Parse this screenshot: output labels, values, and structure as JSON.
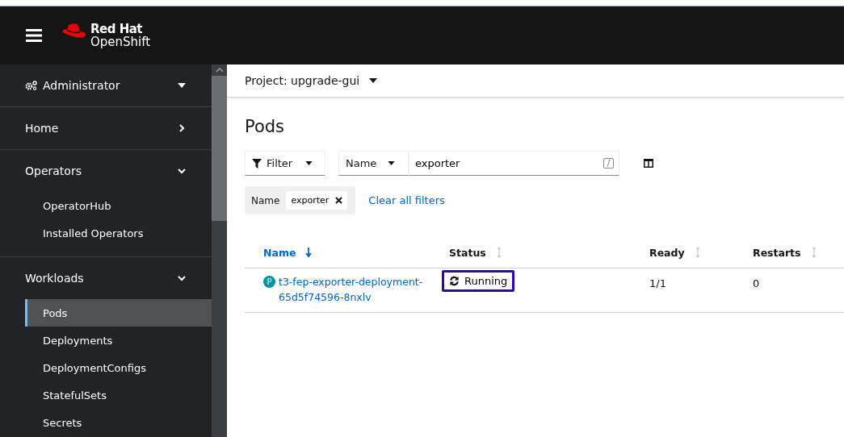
{
  "header": {
    "brand_line_1": "Red Hat",
    "brand_line_2": "OpenShift"
  },
  "sidebar": {
    "perspective": {
      "label": "Administrator",
      "expanded": false
    },
    "sections": [
      {
        "label": "Home",
        "expanded": false
      },
      {
        "label": "Operators",
        "expanded": true,
        "children": [
          {
            "label": "OperatorHub",
            "selected": false
          },
          {
            "label": "Installed Operators",
            "selected": false
          }
        ]
      },
      {
        "label": "Workloads",
        "expanded": true,
        "children": [
          {
            "label": "Pods",
            "selected": true
          },
          {
            "label": "Deployments",
            "selected": false
          },
          {
            "label": "DeploymentConfigs",
            "selected": false
          },
          {
            "label": "StatefulSets",
            "selected": false
          },
          {
            "label": "Secrets",
            "selected": false
          }
        ]
      }
    ]
  },
  "project_bar": {
    "label": "Project: upgrade-gui"
  },
  "page_title": "Pods",
  "toolbar": {
    "filter_button": "Filter",
    "attribute_dropdown": "Name",
    "search_value": "exporter",
    "shortcut_key": "/"
  },
  "active_filters": {
    "category": "Name",
    "chips": [
      "exporter"
    ],
    "clear_link": "Clear all filters"
  },
  "table": {
    "columns": [
      {
        "label": "Name",
        "sorted": true
      },
      {
        "label": "Status",
        "sorted": false
      },
      {
        "label": "Ready",
        "sorted": false
      },
      {
        "label": "Restarts",
        "sorted": false
      }
    ],
    "rows": [
      {
        "badge": "P",
        "name": "t3-fep-exporter-deployment-",
        "name_line_2": "65d5f74596-8nxlv",
        "status": "Running",
        "status_highlighted": true,
        "ready": "1/1",
        "restarts": "0"
      }
    ]
  }
}
